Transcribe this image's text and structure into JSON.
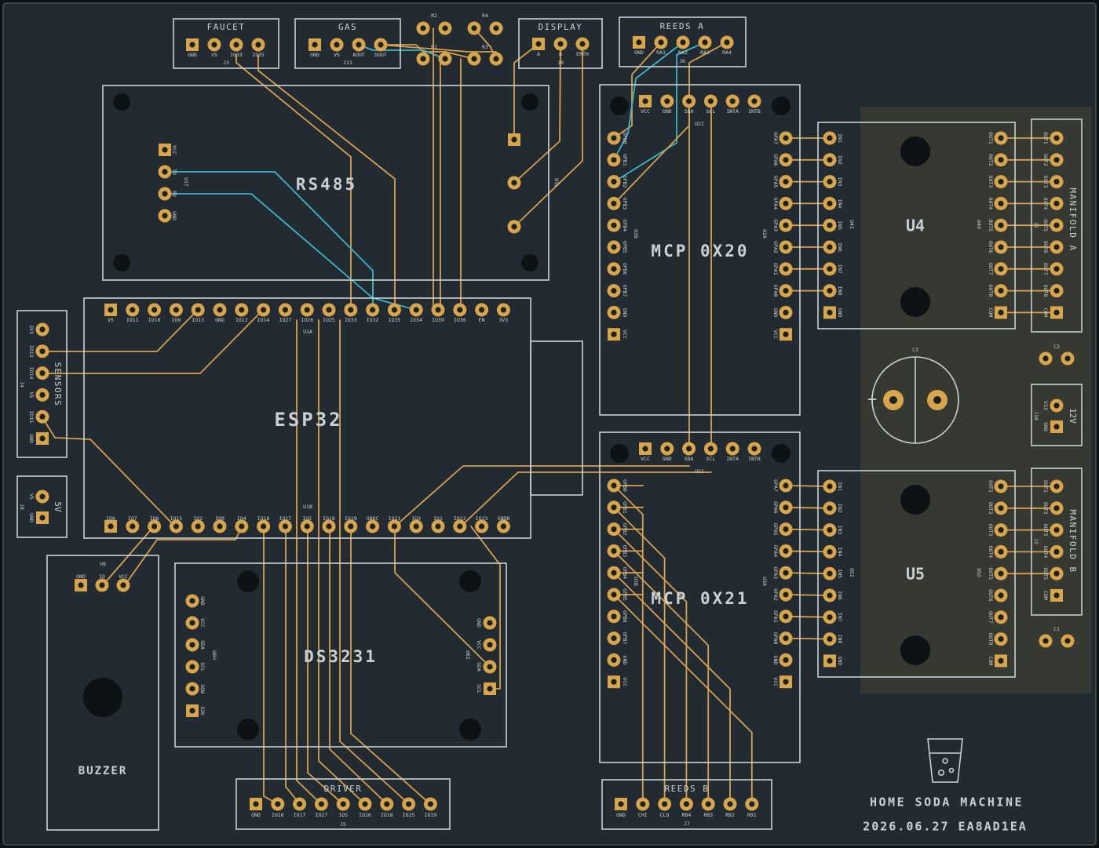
{
  "board": {
    "title": "HOME SODA MACHINE",
    "date_code": "2026.06.27 EA8AD1EA",
    "colors": {
      "substrate": "#212b31",
      "copper": "#d9a54a",
      "silk": "#c9d1d3",
      "trace": "#d8a04c",
      "trace_alt": "#3fb6c7",
      "pad_hole": "#1b2226"
    }
  },
  "connectors": {
    "faucet": {
      "title": "FAUCET",
      "ref": "J3",
      "pins": [
        "GND",
        "V5",
        "IO33",
        "IO35"
      ]
    },
    "gas": {
      "title": "GAS",
      "ref": "J11",
      "pins": [
        "GND",
        "V5",
        "AOUT",
        "DOUT"
      ]
    },
    "display": {
      "title": "DISPLAY",
      "ref": "J9",
      "pins": [
        "A",
        "B",
        "ERTH"
      ]
    },
    "reeds_a": {
      "title": "REEDS A",
      "ref": "J6",
      "pins": [
        "GND",
        "RA1",
        "RA2",
        "RA3",
        "RA4"
      ]
    },
    "sensors": {
      "title": "SENSORS",
      "ref": "J4",
      "pins": [
        "3V3",
        "IO13",
        "IO14",
        "V5",
        "IO15",
        "GND"
      ]
    },
    "v5": {
      "title": "5V",
      "ref": "J8",
      "pins": [
        "V5",
        "GND"
      ]
    },
    "v12": {
      "title": "12V",
      "ref": "J10",
      "pins": [
        "V12",
        "GND"
      ]
    },
    "manifold_a": {
      "title": "MANIFOLD A",
      "ref": "J1",
      "pins": [
        "OUT1",
        "OUT2",
        "OUT3",
        "OUT4",
        "OUT5",
        "OUT6",
        "OUT7",
        "OUT8",
        "COM"
      ]
    },
    "manifold_b": {
      "title": "MANIFOLD B",
      "ref": "J2",
      "pins": [
        "OUT1",
        "OUT2",
        "OUT3",
        "OUT4",
        "OUT5",
        "COM"
      ]
    },
    "driver": {
      "title": "DRIVER",
      "ref": "J5",
      "pins": [
        "GND",
        "IO16",
        "IO17",
        "IO27",
        "IO5",
        "IO26",
        "IO18",
        "IO25",
        "IO19"
      ]
    },
    "reeds_b": {
      "title": "REEDS B",
      "ref": "J7",
      "pins": [
        "GND",
        "CHI",
        "CLO",
        "RB4",
        "RB3",
        "RB2",
        "RB1"
      ]
    }
  },
  "modules": {
    "rs485": {
      "label": "RS485",
      "ref": "U1T",
      "pins": [
        "VCC",
        "TD",
        "RD",
        "GND"
      ]
    },
    "esp32": {
      "label": "ESP32",
      "ref_top": "U1A",
      "ref_bottom": "U1B",
      "top_pins": [
        "V5",
        "IO11",
        "IO10",
        "IO9",
        "IO13",
        "GND",
        "IO12",
        "IO14",
        "IO27",
        "IO26",
        "IO25",
        "IO33",
        "IO32",
        "IO35",
        "IO34",
        "IO39",
        "IO36",
        "EN",
        "3V3"
      ],
      "bottom_pins": [
        "IO6",
        "IO7",
        "IO8",
        "IO15",
        "IO2",
        "IO0",
        "IO4",
        "IO16",
        "IO17",
        "IO5",
        "IO18",
        "IO19",
        "GNDC",
        "IO21",
        "IO3",
        "IO1",
        "IO22",
        "IO23",
        "GNDB"
      ]
    },
    "mcp_a": {
      "label": "MCP 0X20",
      "ref_top": "U2I",
      "ref_left": "U2B",
      "ref_right": "U2A",
      "top_pins": [
        "VCC",
        "GND",
        "SDA",
        "SCL",
        "INTA",
        "INTB"
      ],
      "left_pins": [
        "GPB0",
        "GPB1",
        "GPB2",
        "GPB3",
        "GPB4",
        "GPB5",
        "GPB6",
        "GPB7",
        "GND",
        "VCC"
      ],
      "right_pins": [
        "GPA7",
        "GPA6",
        "GPA5",
        "GPA4",
        "GPA3",
        "GPA2",
        "GPA1",
        "GPA0",
        "GND",
        "VCC"
      ]
    },
    "mcp_b": {
      "label": "MCP 0X21",
      "ref_top": "U3I",
      "ref_left": "U3B",
      "ref_right": "U3A",
      "top_pins": [
        "VCC",
        "GND",
        "SDA",
        "SCL",
        "INTA",
        "INTB"
      ],
      "left_pins": [
        "GPB0",
        "GPB1",
        "GPB2",
        "GPB3",
        "GPB4",
        "GPB5",
        "GPB6",
        "GPB7",
        "GND",
        "VCC"
      ],
      "right_pins": [
        "GPA7",
        "GPA6",
        "GPA5",
        "GPA4",
        "GPA3",
        "GPA2",
        "GPA1",
        "GPA0",
        "GND",
        "VCC"
      ]
    },
    "u4": {
      "label": "U4",
      "ref_in": "U4I",
      "ref_out": "U4O",
      "in_pins": [
        "IN1",
        "IN2",
        "IN3",
        "IN4",
        "IN5",
        "IN6",
        "IN7",
        "IN8",
        "GND"
      ],
      "out_pins": [
        "OUT1",
        "OUT2",
        "OUT3",
        "OUT4",
        "OUT5",
        "OUT6",
        "OUT7",
        "OUT8",
        "COM"
      ]
    },
    "u5": {
      "label": "U5",
      "ref_in": "U5I",
      "ref_out": "U5O",
      "in_pins": [
        "IN1",
        "IN2",
        "IN3",
        "IN4",
        "IN5",
        "IN6",
        "IN7",
        "IN8",
        "GND"
      ],
      "out_pins": [
        "OUT1",
        "OUT2",
        "OUT3",
        "OUT4",
        "OUT5",
        "OUT6",
        "OUT7",
        "OUT8",
        "COM"
      ]
    },
    "ds3231": {
      "label": "DS3231",
      "ref_left": "U6H",
      "ref_right": "U6I",
      "left_pins": [
        "GND",
        "VCC",
        "SDA",
        "SCL",
        "SQW",
        "32K"
      ],
      "right_pins": [
        "GND",
        "VCC",
        "SDA",
        "SCL"
      ]
    },
    "buzzer": {
      "label": "BUZZER",
      "ref": "U8",
      "pins": [
        "GND",
        "IO",
        "VCC"
      ]
    },
    "display_hdr": {
      "ref": "U1L"
    }
  },
  "passives": {
    "r1": "R1",
    "r2": "R2",
    "r3": "R3",
    "r4": "R4",
    "c1": "C1",
    "c2": "C2",
    "c3": "C3",
    "c3_plus": "+"
  }
}
